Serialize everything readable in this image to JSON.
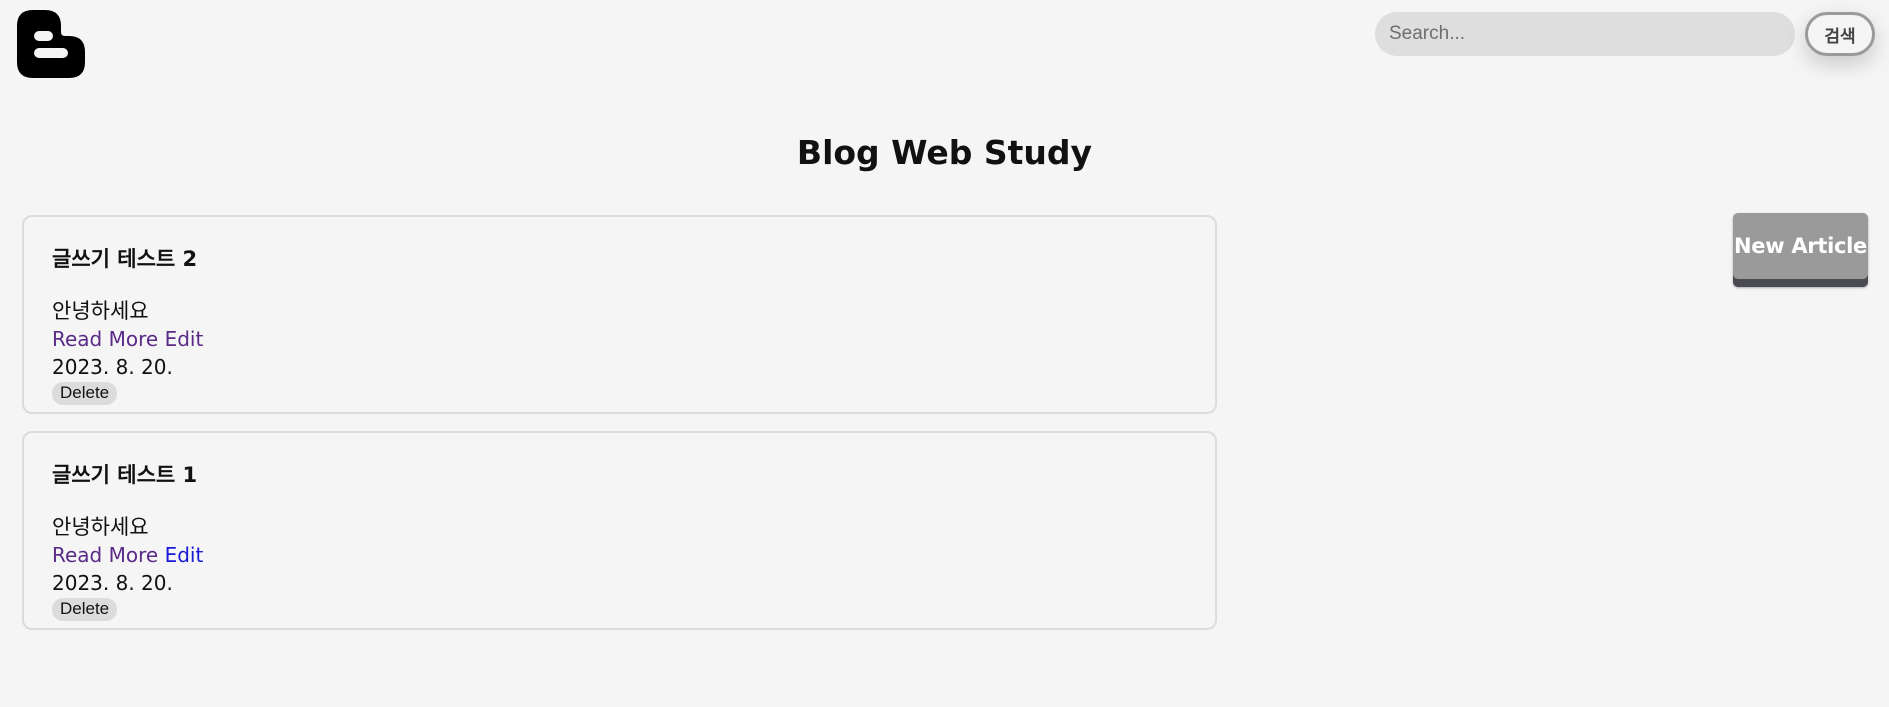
{
  "header": {
    "logo_icon": "blogger-logo-icon",
    "search": {
      "placeholder": "Search...",
      "value": "",
      "button_label": "검색"
    }
  },
  "main": {
    "title": "Blog Web Study",
    "new_article_label": "New Article",
    "articles": [
      {
        "title": "글쓰기 테스트 2",
        "body": "안녕하세요",
        "read_more_label": "Read More",
        "edit_label": "Edit",
        "date": "2023. 8. 20.",
        "delete_label": "Delete"
      },
      {
        "title": "글쓰기 테스트 1",
        "body": "안녕하세요",
        "read_more_label": "Read More",
        "edit_label": "Edit",
        "date": "2023. 8. 20.",
        "delete_label": "Delete"
      }
    ]
  },
  "colors": {
    "background": "#f5f5f5",
    "link_visited": "#5a2a87",
    "link_unvisited": "#1a1ad6",
    "new_article_button": "#9a9a9a"
  }
}
